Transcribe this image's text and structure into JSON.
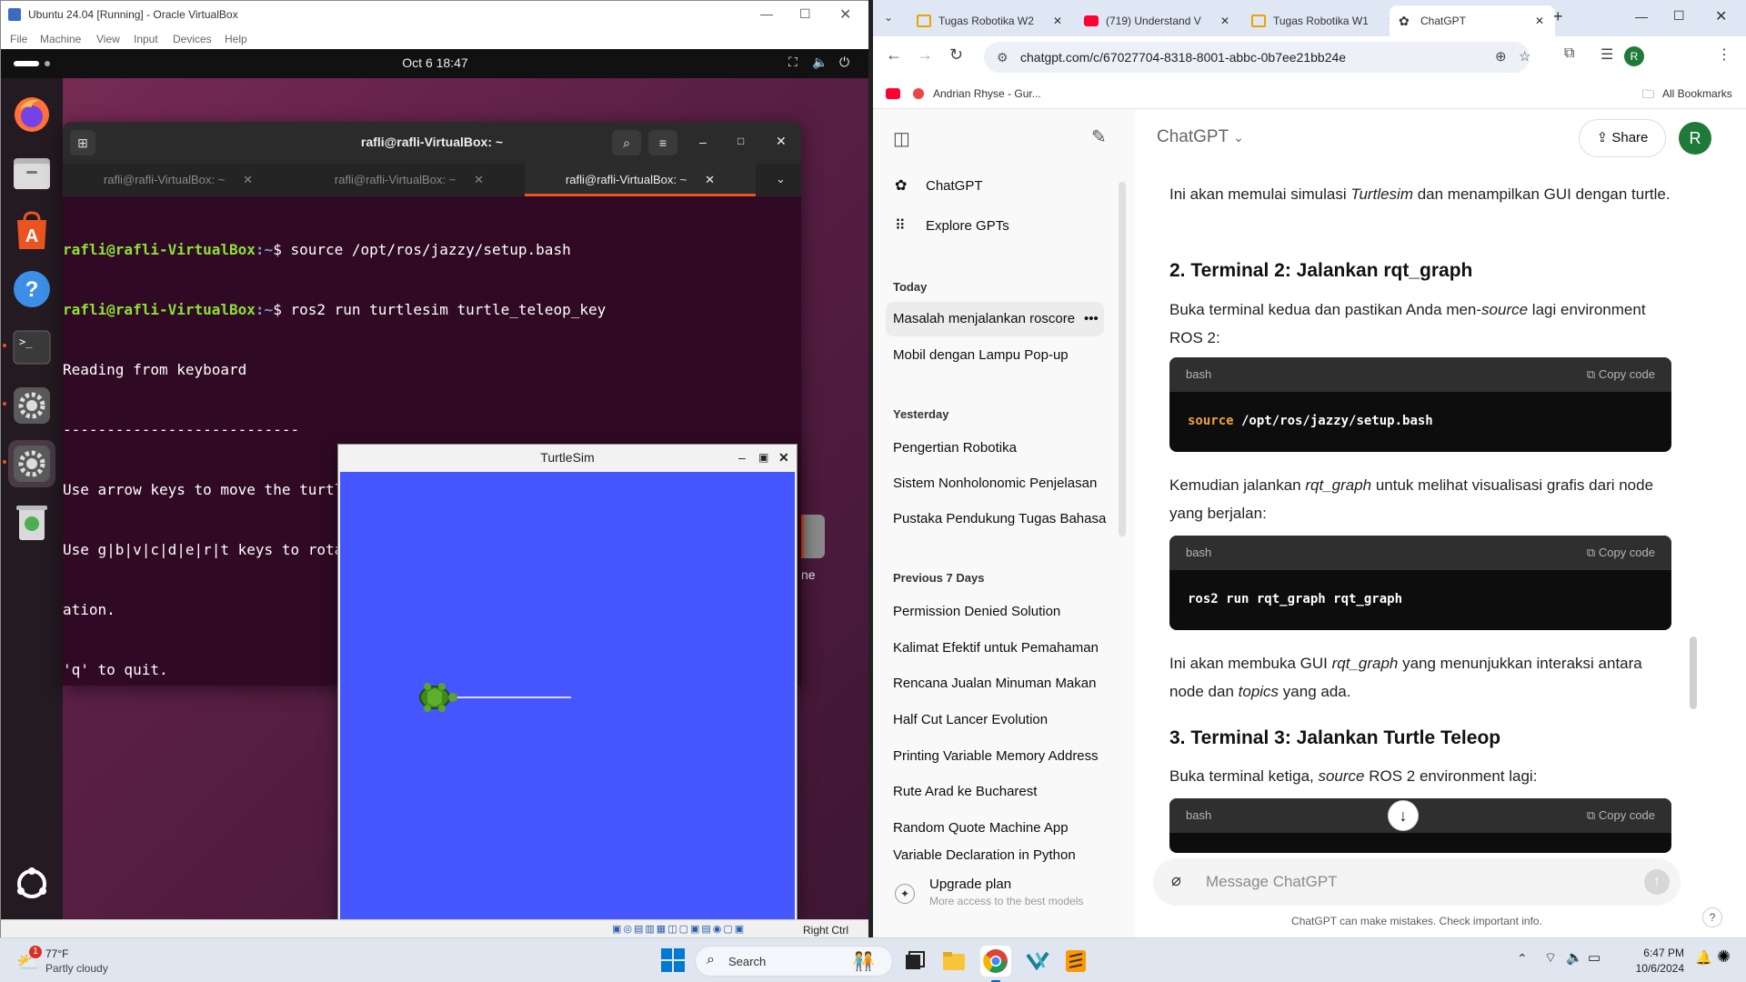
{
  "vbox": {
    "title": "Ubuntu 24.04 [Running] - Oracle VirtualBox",
    "menu": [
      "File",
      "Machine",
      "View",
      "Input",
      "Devices",
      "Help"
    ],
    "status_right": "Right Ctrl"
  },
  "ubuntu": {
    "date_time": "Oct 6  18:47",
    "dock": [
      "firefox-icon",
      "files-icon",
      "app-center-icon",
      "help-icon",
      "terminal-icon",
      "settings-icon",
      "settings-icon",
      "trash-icon",
      "show-apps-icon"
    ],
    "behind_label": "ne"
  },
  "terminal": {
    "title": "rafli@rafli-VirtualBox: ~",
    "tabs": [
      "rafli@rafli-VirtualBox: ~",
      "rafli@rafli-VirtualBox: ~",
      "rafli@rafli-VirtualBox: ~"
    ],
    "prompt_user": "rafli@rafli-VirtualBox",
    "prompt_path": ":~",
    "prompt_sym": "$ ",
    "cmd1": "source /opt/ros/jazzy/setup.bash",
    "cmd2": "ros2 run turtlesim turtle_teleop_key",
    "out1": "Reading from keyboard",
    "out2": "---------------------------",
    "out3": "Use arrow keys to move the turtle.",
    "out4": "Use g|b|v|c|d|e|r|t keys to rotate to absolute orientations. 'f' to cancel a rot",
    "out5": "ation.",
    "out6": "'q' to quit."
  },
  "turtlesim": {
    "title": "TurtleSim",
    "bg_color": "#4556ff"
  },
  "chrome": {
    "tabs": [
      {
        "label": "Tugas Robotika W2",
        "icon": "docs-icon"
      },
      {
        "label": "(719) Understand V",
        "icon": "youtube-icon"
      },
      {
        "label": "Tugas Robotika W1",
        "icon": "docs-icon"
      },
      {
        "label": "ChatGPT",
        "icon": "chatgpt-icon"
      }
    ],
    "url": "chatgpt.com/c/67027704-8318-8001-abbc-0b7ee21bb24e",
    "bookmark1": "Andrian Rhyse - Gur...",
    "all_bookmarks": "All Bookmarks",
    "profile_initial": "R"
  },
  "chatgpt": {
    "model": "ChatGPT",
    "share": "Share",
    "avatar": "R",
    "nav": [
      "ChatGPT",
      "Explore GPTs"
    ],
    "today_head": "Today",
    "today": [
      "Masalah menjalankan roscore",
      "Mobil dengan Lampu Pop-up"
    ],
    "yesterday_head": "Yesterday",
    "yesterday": [
      "Pengertian Robotika",
      "Sistem Nonholonomic Penjelasan",
      "Pustaka Pendukung Tugas Bahasa"
    ],
    "prev_head": "Previous 7 Days",
    "prev": [
      "Permission Denied Solution",
      "Kalimat Efektif untuk Pemahaman",
      "Rencana Jualan Minuman Makan",
      "Half Cut Lancer Evolution",
      "Printing Variable Memory Address",
      "Rute Arad ke Bucharest",
      "Random Quote Machine App",
      "Variable Declaration in Python"
    ],
    "upgrade_title": "Upgrade plan",
    "upgrade_sub": "More access to the best models",
    "p1a": "Ini akan memulai simulasi ",
    "p1b": "Turtlesim",
    "p1c": " dan menampilkan GUI dengan turtle.",
    "h2": "2. Terminal 2: Jalankan rqt_graph",
    "p2a": "Buka terminal kedua dan pastikan Anda men-",
    "p2b": "source",
    "p2c": " lagi environment ROS 2:",
    "code_lang": "bash",
    "copy": "Copy code",
    "code1_kw": "source",
    "code1_rest": " /opt/ros/jazzy/setup.bash",
    "p3a": "Kemudian jalankan ",
    "p3b": "rqt_graph",
    "p3c": " untuk melihat visualisasi grafis dari node yang berjalan:",
    "code2": "ros2 run rqt_graph rqt_graph",
    "p4a": "Ini akan membuka GUI ",
    "p4b": "rqt_graph",
    "p4c": " yang menunjukkan interaksi antara node dan ",
    "p4d": "topics",
    "p4e": " yang ada.",
    "h3": "3. Terminal 3: Jalankan Turtle Teleop",
    "p5a": "Buka terminal ketiga, ",
    "p5b": "source",
    "p5c": " ROS 2 environment lagi:",
    "input_placeholder": "Message ChatGPT",
    "disclaimer": "ChatGPT can make mistakes. Check important info.",
    "help": "?"
  },
  "taskbar": {
    "weather_temp": "77°F",
    "weather_desc": "Partly cloudy",
    "weather_badge": "1",
    "search": "Search",
    "time": "6:47 PM",
    "date": "10/6/2024"
  }
}
